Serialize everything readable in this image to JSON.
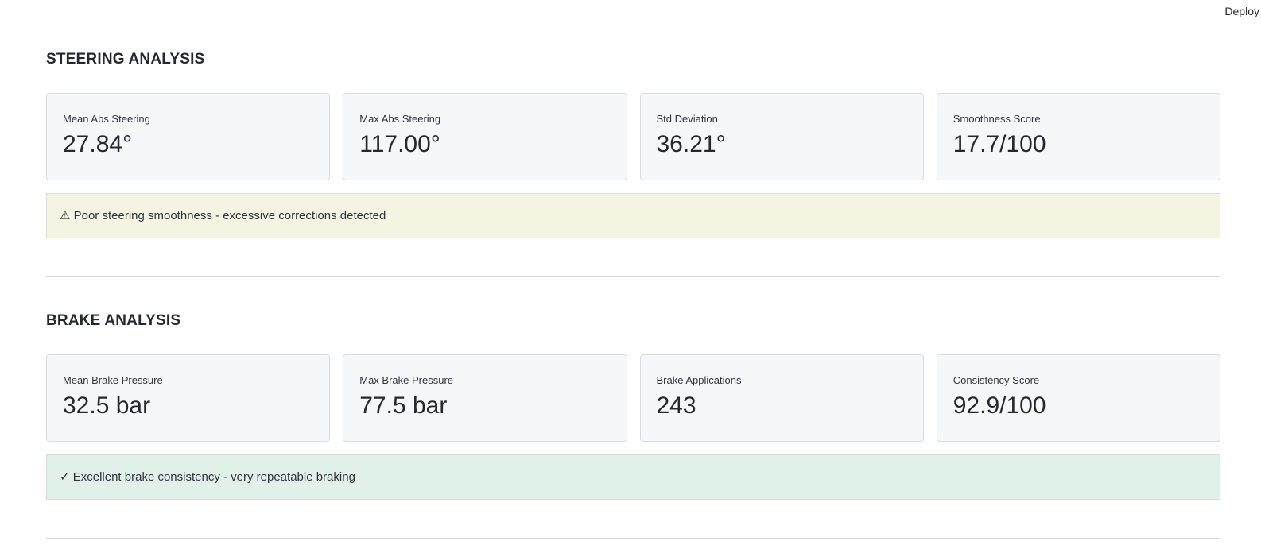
{
  "header": {
    "deploy_label": "Deploy"
  },
  "steering": {
    "title": "STEERING ANALYSIS",
    "metrics": [
      {
        "label": "Mean Abs Steering",
        "value": "27.84°"
      },
      {
        "label": "Max Abs Steering",
        "value": "117.00°"
      },
      {
        "label": "Std Deviation",
        "value": "36.21°"
      },
      {
        "label": "Smoothness Score",
        "value": "17.7/100"
      }
    ],
    "alert": {
      "type": "warning",
      "text": "⚠ Poor steering smoothness - excessive corrections detected"
    }
  },
  "brake": {
    "title": "BRAKE ANALYSIS",
    "metrics": [
      {
        "label": "Mean Brake Pressure",
        "value": "32.5 bar"
      },
      {
        "label": "Max Brake Pressure",
        "value": "77.5 bar"
      },
      {
        "label": "Brake Applications",
        "value": "243"
      },
      {
        "label": "Consistency Score",
        "value": "92.9/100"
      }
    ],
    "alert": {
      "type": "success",
      "text": "✓ Excellent brake consistency - very repeatable braking"
    }
  },
  "colors": {
    "warning_bg": "#f5f4e3",
    "success_bg": "#dff1e8",
    "card_bg": "#f6f7f9"
  }
}
